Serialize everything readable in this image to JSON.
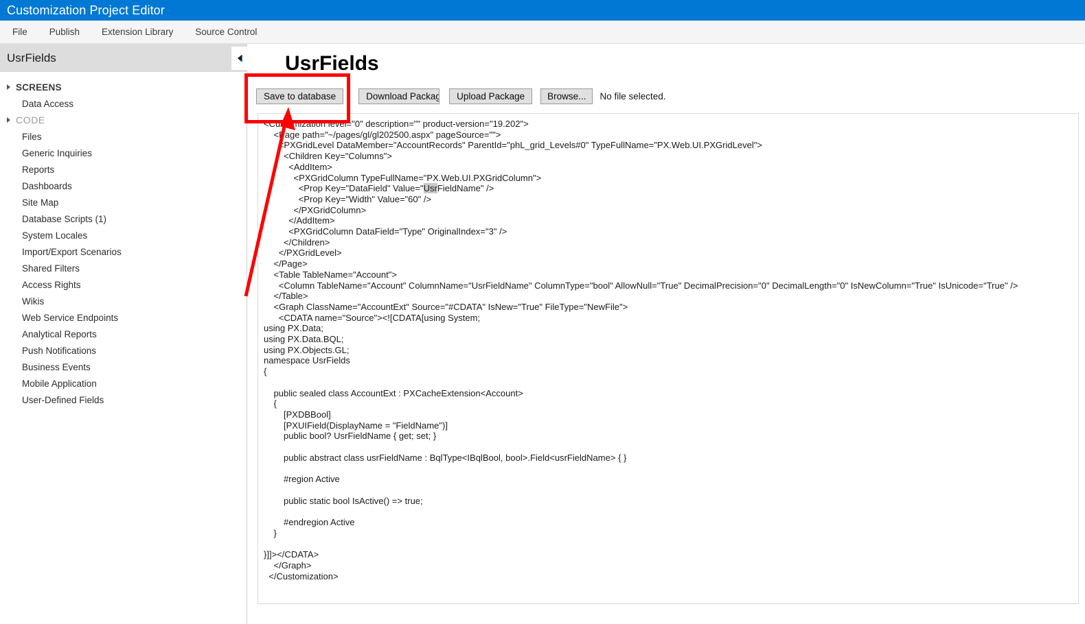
{
  "window": {
    "title": "Customization Project Editor",
    "title_bar_color": "#0078d4"
  },
  "menubar": {
    "items": [
      {
        "label": "File"
      },
      {
        "label": "Publish"
      },
      {
        "label": "Extension Library"
      },
      {
        "label": "Source Control"
      }
    ]
  },
  "sidebar": {
    "project_name": "UsrFields",
    "collapse_icon": "triangle-left-icon",
    "items": [
      {
        "label": "SCREENS",
        "type": "group",
        "expandable": true,
        "dim": false
      },
      {
        "label": "Data Access",
        "type": "child",
        "expandable": false,
        "dim": false
      },
      {
        "label": "CODE",
        "type": "group",
        "expandable": true,
        "dim": true
      },
      {
        "label": "Files",
        "type": "child",
        "expandable": false,
        "dim": false
      },
      {
        "label": "Generic Inquiries",
        "type": "child",
        "expandable": false,
        "dim": false
      },
      {
        "label": "Reports",
        "type": "child",
        "expandable": false,
        "dim": false
      },
      {
        "label": "Dashboards",
        "type": "child",
        "expandable": false,
        "dim": false
      },
      {
        "label": "Site Map",
        "type": "child",
        "expandable": false,
        "dim": false
      },
      {
        "label": "Database Scripts (1)",
        "type": "child",
        "expandable": false,
        "dim": false
      },
      {
        "label": "System Locales",
        "type": "child",
        "expandable": false,
        "dim": false
      },
      {
        "label": "Import/Export Scenarios",
        "type": "child",
        "expandable": false,
        "dim": false
      },
      {
        "label": "Shared Filters",
        "type": "child",
        "expandable": false,
        "dim": false
      },
      {
        "label": "Access Rights",
        "type": "child",
        "expandable": false,
        "dim": false
      },
      {
        "label": "Wikis",
        "type": "child",
        "expandable": false,
        "dim": false
      },
      {
        "label": "Web Service Endpoints",
        "type": "child",
        "expandable": false,
        "dim": false
      },
      {
        "label": "Analytical Reports",
        "type": "child",
        "expandable": false,
        "dim": false
      },
      {
        "label": "Push Notifications",
        "type": "child",
        "expandable": false,
        "dim": false
      },
      {
        "label": "Business Events",
        "type": "child",
        "expandable": false,
        "dim": false
      },
      {
        "label": "Mobile Application",
        "type": "child",
        "expandable": false,
        "dim": false
      },
      {
        "label": "User-Defined Fields",
        "type": "child",
        "expandable": false,
        "dim": false
      }
    ]
  },
  "main": {
    "page_title": "UsrFields",
    "toolbar": {
      "save_label": "Save to database",
      "download_label": "Download Package",
      "upload_label": "Upload Package",
      "browse_label": "Browse...",
      "file_status": "No file selected."
    },
    "code_before_selection": "<Customization level=\"0\" description=\"\" product-version=\"19.202\">\n    <Page path=\"~/pages/gl/gl202500.aspx\" pageSource=\"\">\n      <PXGridLevel DataMember=\"AccountRecords\" ParentId=\"phL_grid_Levels#0\" TypeFullName=\"PX.Web.UI.PXGridLevel\">\n        <Children Key=\"Columns\">\n          <AddItem>\n            <PXGridColumn TypeFullName=\"PX.Web.UI.PXGridColumn\">\n              <Prop Key=\"DataField\" Value=\"",
    "code_selection": "Usr",
    "code_after_selection": "FieldName\" />\n              <Prop Key=\"Width\" Value=\"60\" />\n            </PXGridColumn>\n          </AddItem>\n          <PXGridColumn DataField=\"Type\" OriginalIndex=\"3\" />\n        </Children>\n      </PXGridLevel>\n    </Page>\n    <Table TableName=\"Account\">\n      <Column TableName=\"Account\" ColumnName=\"UsrFieldName\" ColumnType=\"bool\" AllowNull=\"True\" DecimalPrecision=\"0\" DecimalLength=\"0\" IsNewColumn=\"True\" IsUnicode=\"True\" />\n    </Table>\n    <Graph ClassName=\"AccountExt\" Source=\"#CDATA\" IsNew=\"True\" FileType=\"NewFile\">\n      <CDATA name=\"Source\"><![CDATA[using System;\nusing PX.Data;\nusing PX.Data.BQL;\nusing PX.Objects.GL;\nnamespace UsrFields\n{\n\n    public sealed class AccountExt : PXCacheExtension<Account>\n    {\n        [PXDBBool]\n        [PXUIField(DisplayName = \"FieldName\")]\n        public bool? UsrFieldName { get; set; }\n\n        public abstract class usrFieldName : BqlType<IBqlBool, bool>.Field<usrFieldName> { }\n\n        #region Active\n\n        public static bool IsActive() => true;\n\n        #endregion Active\n    }\n\n}]]></CDATA>\n    </Graph>\n  </Customization>"
  },
  "annotation": {
    "highlight_color": "#ff0000",
    "box_target": "save-to-database-button",
    "arrow_points_to": "save-to-database-button"
  }
}
